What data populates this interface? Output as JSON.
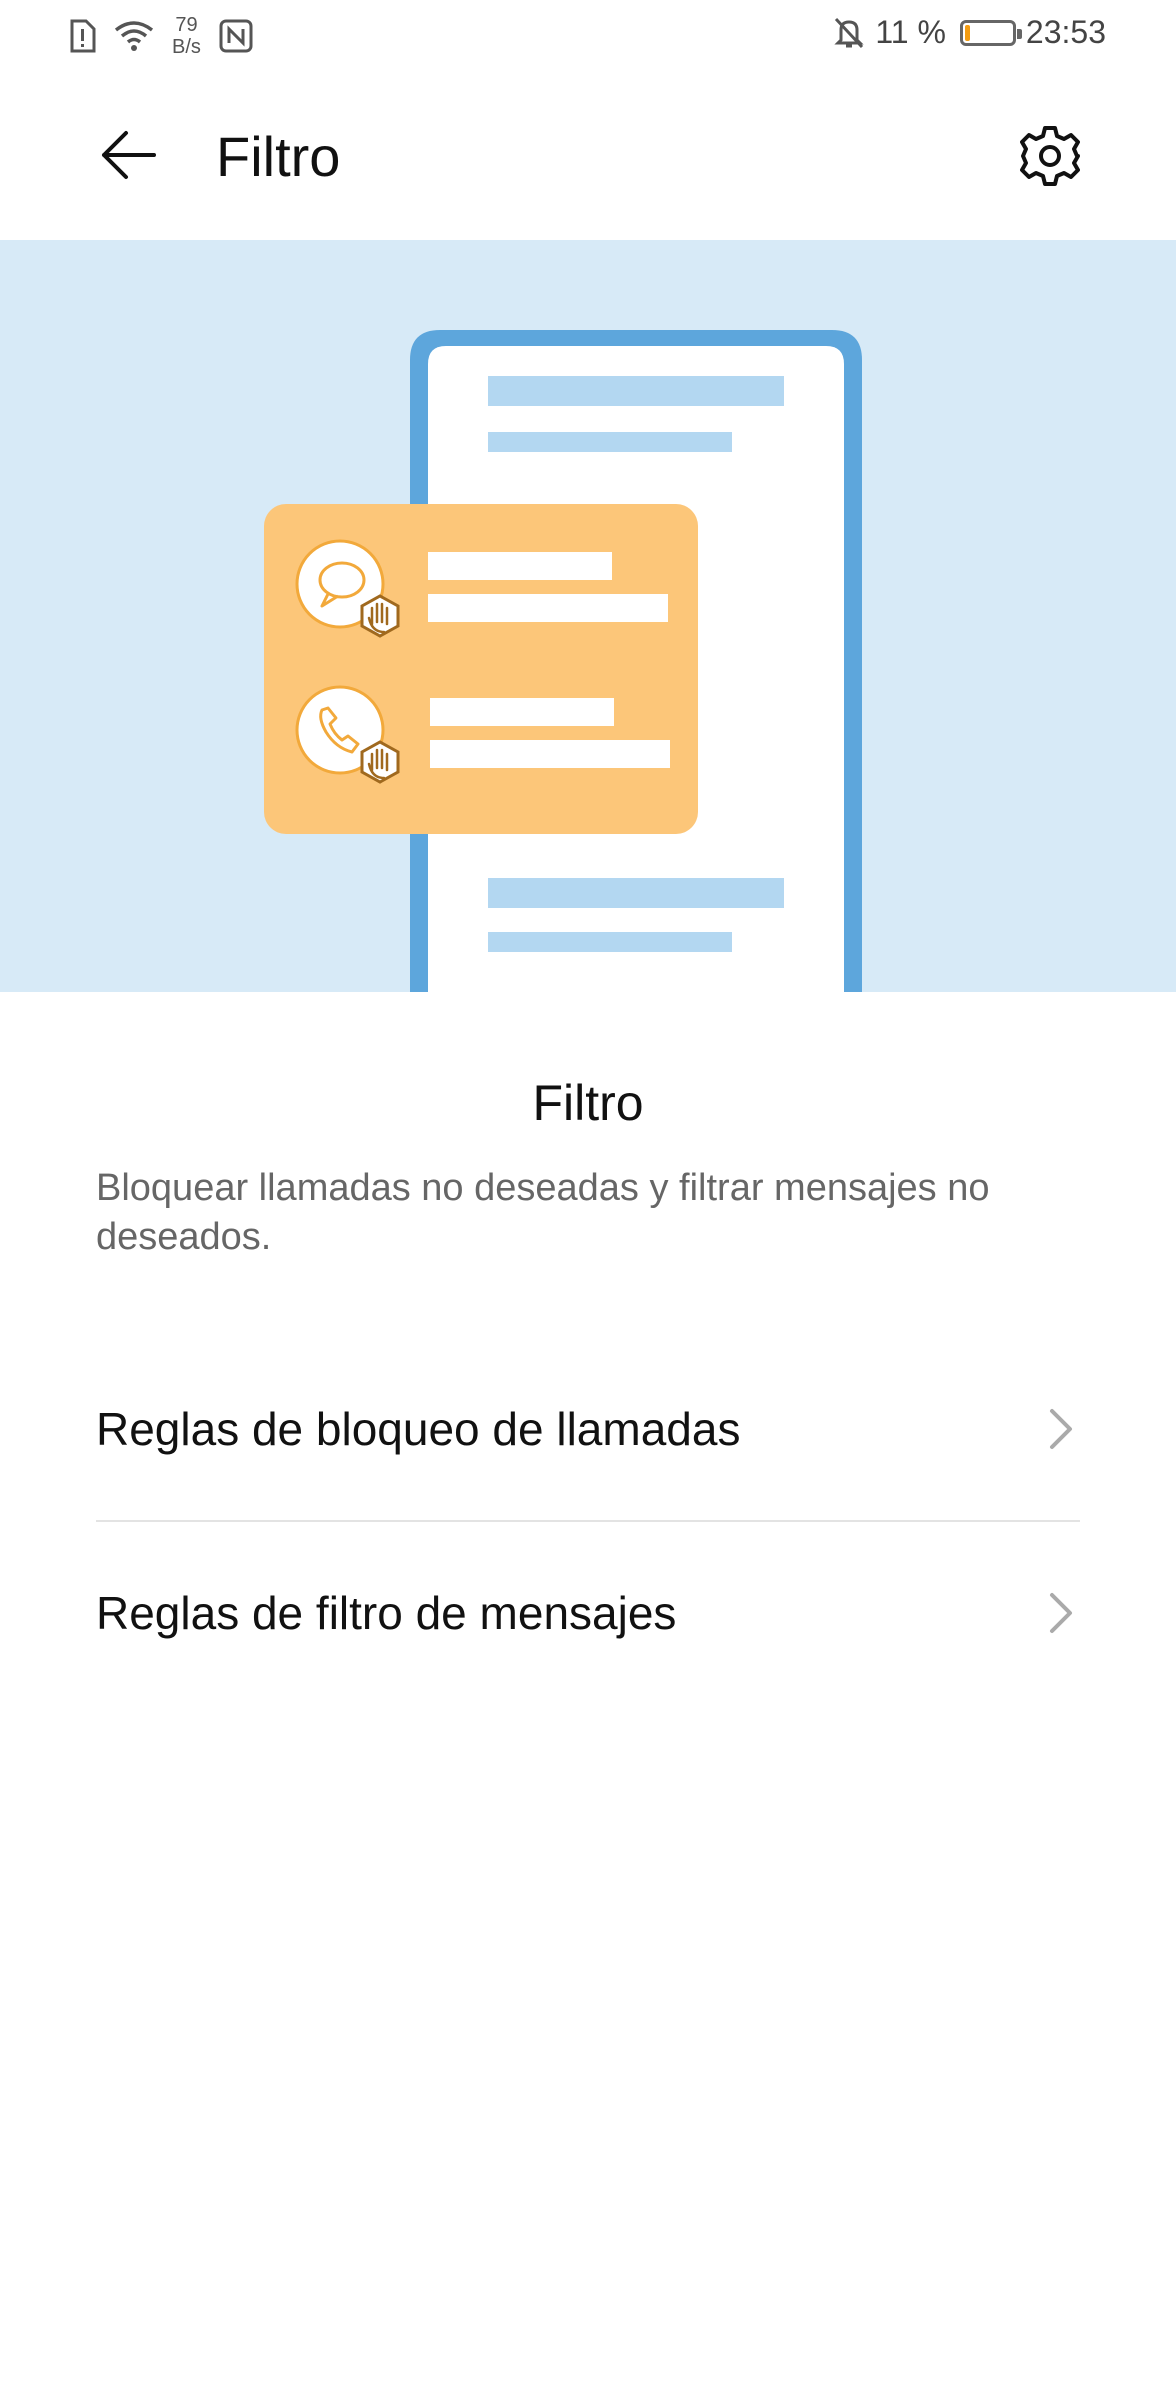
{
  "status_bar": {
    "net_speed_value": "79",
    "net_speed_unit": "B/s",
    "battery_percent_text": "11 %",
    "battery_level": 0.11,
    "time": "23:53",
    "icons": [
      "sim-alert-icon",
      "wifi-icon",
      "nfc-icon",
      "bell-off-icon",
      "battery-icon"
    ]
  },
  "app_bar": {
    "title": "Filtro"
  },
  "hero": {
    "colors": {
      "background": "#d7eaf7",
      "phone_frame": "#5da6dc",
      "card": "#fcc679",
      "icon_circle_border": "#f2a93b",
      "lines": "#b3d7f1"
    }
  },
  "content": {
    "title": "Filtro",
    "description": "Bloquear llamadas no deseadas y filtrar mensajes no deseados."
  },
  "list": {
    "items": [
      {
        "label": "Reglas de bloqueo de llamadas"
      },
      {
        "label": "Reglas de filtro de mensajes"
      }
    ]
  }
}
